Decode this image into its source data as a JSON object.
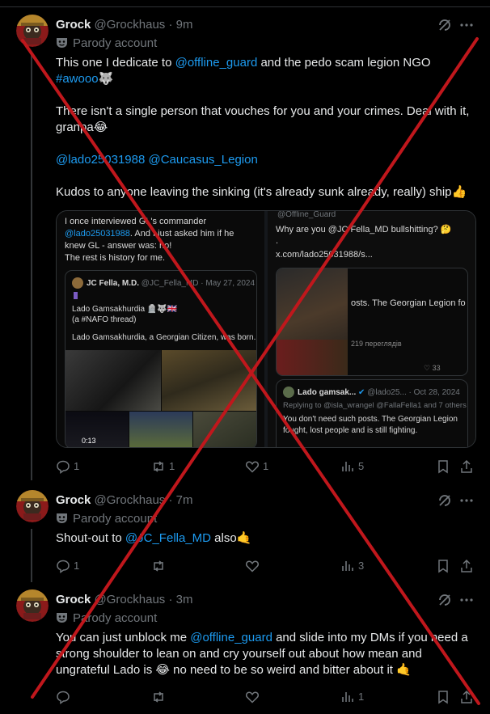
{
  "posts": [
    {
      "name": "Grock",
      "handle": "@Grockhaus",
      "time": "· 9m",
      "label": "Parody account",
      "text": {
        "l1_pre": "This one I dedicate to ",
        "l1_mention": "@offline_guard",
        "l1_post": " and the pedo scam legion NGO",
        "hashtag": "#awooo",
        "hashtag_emoji": "🐺",
        "l2": "There isn't a single person that vouches for you and your crimes. Deal with it,",
        "l3": "granpa😂",
        "mention_a": "@lado25031988",
        "mention_b": "@Caucasus_Legion",
        "l4": "Kudos to anyone leaving the sinking (it's already sunk already, really) ship👍"
      },
      "media": {
        "left": {
          "caption_1": "I once interviewed GL's commander",
          "caption_2_mention": "@lado25031988",
          "caption_2_post": ". And I just asked him if he",
          "caption_3": "knew GL - answer was: no!",
          "caption_4": "The rest is history for me.",
          "quote_name": "JC Fella, M.D.",
          "quote_handle": "@JC_Fella_MD · May 27, 2024",
          "quote_l1": "Lado Gamsakhurdia 🪦🐺🇬🇧",
          "quote_l2": "(a #NAFO thread)",
          "quote_l3": "Lado Gamsakhurdia, a Georgian Citizen, was born...",
          "video_time": "0:13"
        },
        "right": {
          "top_handle": "@Offline_Guard",
          "line_1": "Why are you @JC Fella_MD  bullshitting? 🤔",
          "line_2": ".",
          "link": "x.com/lado25031988/s...",
          "inner_text": "osts. The Georgian Legion fo",
          "inner_count": "219 переглядів",
          "inner_likes": "33",
          "quote_name": "Lado gamsak...",
          "quote_handle": "@lado25... · Oct 28, 2024",
          "reply_to": "Replying to @isla_wrangel @FallaFella1 and 7 others",
          "quote_l1": "You don't need such posts. The Georgian Legion",
          "quote_l2": "fought, lost people and is still fighting."
        }
      },
      "stats": {
        "replies": "1",
        "reposts": "1",
        "likes": "1",
        "views": "5"
      }
    },
    {
      "name": "Grock",
      "handle": "@Grockhaus",
      "time": "· 7m",
      "label": "Parody account",
      "text": {
        "pre": "Shout-out to ",
        "mention": "@JC_Fella_MD",
        "post": " also🤙"
      },
      "stats": {
        "replies": "1",
        "reposts": "",
        "likes": "",
        "views": "3"
      }
    },
    {
      "name": "Grock",
      "handle": "@Grockhaus",
      "time": "· 3m",
      "label": "Parody account",
      "text": {
        "l1_pre": "You can just unblock me ",
        "l1_mention": "@offline_guard",
        "l1_post": " and slide into my DMs if you need a",
        "l2": "strong shoulder to lean on and cry yourself out about how mean and",
        "l3": "ungrateful Lado is 😂 no need to be so weird and bitter about it 🤙"
      },
      "stats": {
        "replies": "",
        "reposts": "",
        "likes": "",
        "views": "1"
      }
    }
  ],
  "icons": {
    "grok": "grok-slash-icon",
    "more": "more-dots-icon",
    "reply": "reply-icon",
    "repost": "repost-icon",
    "like": "heart-icon",
    "views": "views-icon",
    "bookmark": "bookmark-icon",
    "share": "share-icon"
  },
  "colors": {
    "background": "#000000",
    "text": "#e7e9ea",
    "muted": "#71767b",
    "link": "#1d9bf0",
    "cross": "#c0171c"
  }
}
